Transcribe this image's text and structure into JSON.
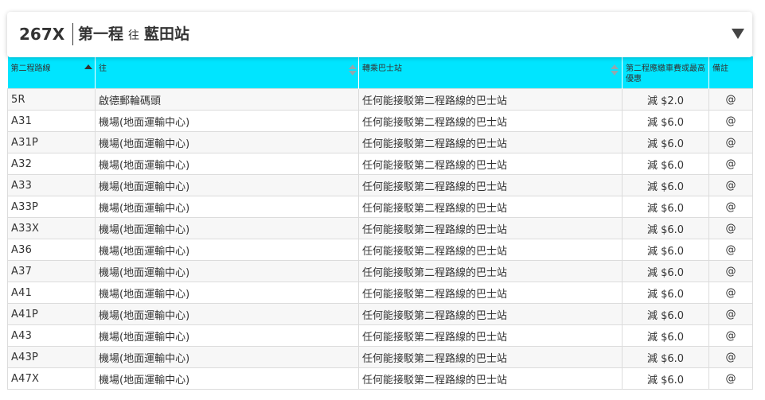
{
  "header": {
    "route_number": "267X",
    "destination_prefix": "第一程",
    "towards": "往",
    "destination": "藍田站"
  },
  "table": {
    "columns": [
      {
        "label": "第二程路線"
      },
      {
        "label": "往"
      },
      {
        "label": "轉乘巴士站"
      },
      {
        "label": "第二程應繳車費或最高優惠"
      },
      {
        "label": "備註"
      }
    ],
    "rows": [
      {
        "route": "5R",
        "towards": "啟德郵輪碼頭",
        "stop": "任何能接駁第二程路線的巴士站",
        "fare": "減 $2.0",
        "note": "@"
      },
      {
        "route": "A31",
        "towards": "機場(地面運輸中心)",
        "stop": "任何能接駁第二程路線的巴士站",
        "fare": "減 $6.0",
        "note": "@"
      },
      {
        "route": "A31P",
        "towards": "機場(地面運輸中心)",
        "stop": "任何能接駁第二程路線的巴士站",
        "fare": "減 $6.0",
        "note": "@"
      },
      {
        "route": "A32",
        "towards": "機場(地面運輸中心)",
        "stop": "任何能接駁第二程路線的巴士站",
        "fare": "減 $6.0",
        "note": "@"
      },
      {
        "route": "A33",
        "towards": "機場(地面運輸中心)",
        "stop": "任何能接駁第二程路線的巴士站",
        "fare": "減 $6.0",
        "note": "@"
      },
      {
        "route": "A33P",
        "towards": "機場(地面運輸中心)",
        "stop": "任何能接駁第二程路線的巴士站",
        "fare": "減 $6.0",
        "note": "@"
      },
      {
        "route": "A33X",
        "towards": "機場(地面運輸中心)",
        "stop": "任何能接駁第二程路線的巴士站",
        "fare": "減 $6.0",
        "note": "@"
      },
      {
        "route": "A36",
        "towards": "機場(地面運輸中心)",
        "stop": "任何能接駁第二程路線的巴士站",
        "fare": "減 $6.0",
        "note": "@"
      },
      {
        "route": "A37",
        "towards": "機場(地面運輸中心)",
        "stop": "任何能接駁第二程路線的巴士站",
        "fare": "減 $6.0",
        "note": "@"
      },
      {
        "route": "A41",
        "towards": "機場(地面運輸中心)",
        "stop": "任何能接駁第二程路線的巴士站",
        "fare": "減 $6.0",
        "note": "@"
      },
      {
        "route": "A41P",
        "towards": "機場(地面運輸中心)",
        "stop": "任何能接駁第二程路線的巴士站",
        "fare": "減 $6.0",
        "note": "@"
      },
      {
        "route": "A43",
        "towards": "機場(地面運輸中心)",
        "stop": "任何能接駁第二程路線的巴士站",
        "fare": "減 $6.0",
        "note": "@"
      },
      {
        "route": "A43P",
        "towards": "機場(地面運輸中心)",
        "stop": "任何能接駁第二程路線的巴士站",
        "fare": "減 $6.0",
        "note": "@"
      },
      {
        "route": "A47X",
        "towards": "機場(地面運輸中心)",
        "stop": "任何能接駁第二程路線的巴士站",
        "fare": "減 $6.0",
        "note": "@"
      }
    ]
  },
  "colors": {
    "header_bg": "#00e5ff",
    "row_alt": "#f7f7f7",
    "text": "#333333"
  },
  "icons": {
    "dropdown": "triangle-down-icon",
    "sort": "sort-arrows-icon"
  }
}
